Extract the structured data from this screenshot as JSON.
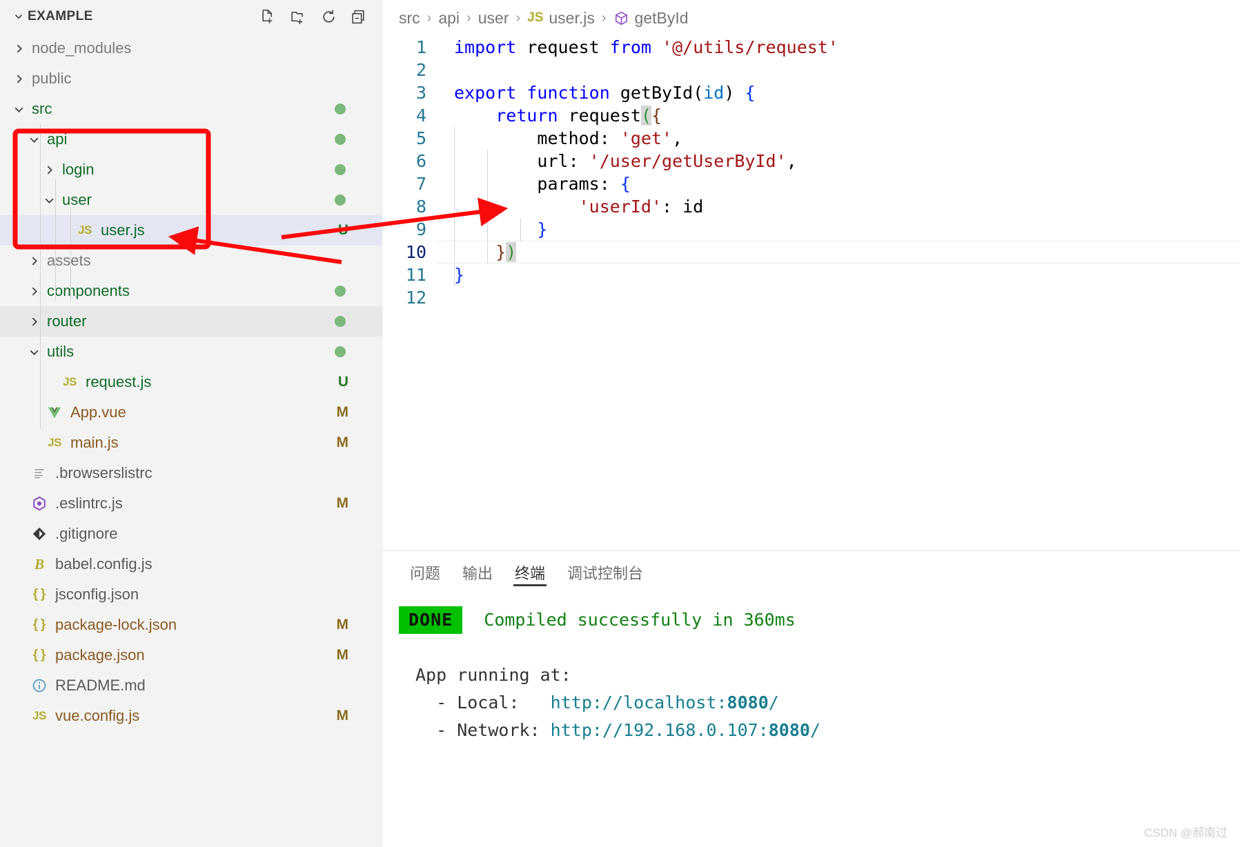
{
  "sidebar": {
    "title": "EXAMPLE",
    "twisty_icon": "chevron-down-icon",
    "actions": [
      {
        "name": "new-file-icon",
        "tooltip": "New File"
      },
      {
        "name": "new-folder-icon",
        "tooltip": "New Folder"
      },
      {
        "name": "refresh-icon",
        "tooltip": "Refresh Explorer"
      },
      {
        "name": "collapse-all-icon",
        "tooltip": "Collapse Folders in Explorer"
      }
    ],
    "tree": [
      {
        "label": "node_modules",
        "type": "folder",
        "state": "collapsed",
        "depth": 0,
        "color": "dim",
        "badge": "",
        "dot": false,
        "selected": false,
        "hover": false
      },
      {
        "label": "public",
        "type": "folder",
        "state": "collapsed",
        "depth": 0,
        "color": "dim",
        "badge": "",
        "dot": false,
        "selected": false,
        "hover": false
      },
      {
        "label": "src",
        "type": "folder",
        "state": "expanded",
        "depth": 0,
        "color": "folder",
        "badge": "",
        "dot": true,
        "selected": false,
        "hover": false
      },
      {
        "label": "api",
        "type": "folder",
        "state": "expanded",
        "depth": 1,
        "color": "folder",
        "badge": "",
        "dot": true,
        "selected": false,
        "hover": false
      },
      {
        "label": "login",
        "type": "folder",
        "state": "collapsed",
        "depth": 2,
        "color": "folder",
        "badge": "",
        "dot": true,
        "selected": false,
        "hover": false
      },
      {
        "label": "user",
        "type": "folder",
        "state": "expanded",
        "depth": 2,
        "color": "folder",
        "badge": "",
        "dot": true,
        "selected": false,
        "hover": false
      },
      {
        "label": "user.js",
        "type": "js",
        "state": "file",
        "depth": 3,
        "color": "folder",
        "badge": "U",
        "dot": false,
        "selected": true,
        "hover": false
      },
      {
        "label": "assets",
        "type": "folder",
        "state": "collapsed",
        "depth": 1,
        "color": "dim",
        "badge": "",
        "dot": false,
        "selected": false,
        "hover": false
      },
      {
        "label": "components",
        "type": "folder",
        "state": "collapsed",
        "depth": 1,
        "color": "folder",
        "badge": "",
        "dot": true,
        "selected": false,
        "hover": false
      },
      {
        "label": "router",
        "type": "folder",
        "state": "collapsed",
        "depth": 1,
        "color": "folder",
        "badge": "",
        "dot": true,
        "selected": false,
        "hover": true
      },
      {
        "label": "utils",
        "type": "folder",
        "state": "expanded",
        "depth": 1,
        "color": "folder",
        "badge": "",
        "dot": true,
        "selected": false,
        "hover": false
      },
      {
        "label": "request.js",
        "type": "js",
        "state": "file",
        "depth": 2,
        "color": "folder",
        "badge": "U",
        "dot": false,
        "selected": false,
        "hover": false
      },
      {
        "label": "App.vue",
        "type": "vue",
        "state": "file",
        "depth": 1,
        "color": "json",
        "badge": "M",
        "dot": false,
        "selected": false,
        "hover": false
      },
      {
        "label": "main.js",
        "type": "js",
        "state": "file",
        "depth": 1,
        "color": "json",
        "badge": "M",
        "dot": false,
        "selected": false,
        "hover": false
      },
      {
        "label": ".browserslistrc",
        "type": "lines",
        "state": "file",
        "depth": 0,
        "color": "plain",
        "badge": "",
        "dot": false,
        "selected": false,
        "hover": false
      },
      {
        "label": ".eslintrc.js",
        "type": "eslint",
        "state": "file",
        "depth": 0,
        "color": "plain",
        "badge": "M",
        "dot": false,
        "selected": false,
        "hover": false
      },
      {
        "label": ".gitignore",
        "type": "git",
        "state": "file",
        "depth": 0,
        "color": "plain",
        "badge": "",
        "dot": false,
        "selected": false,
        "hover": false
      },
      {
        "label": "babel.config.js",
        "type": "babel",
        "state": "file",
        "depth": 0,
        "color": "plain",
        "badge": "",
        "dot": false,
        "selected": false,
        "hover": false
      },
      {
        "label": "jsconfig.json",
        "type": "json",
        "state": "file",
        "depth": 0,
        "color": "plain",
        "badge": "",
        "dot": false,
        "selected": false,
        "hover": false
      },
      {
        "label": "package-lock.json",
        "type": "json",
        "state": "file",
        "depth": 0,
        "color": "json",
        "badge": "M",
        "dot": false,
        "selected": false,
        "hover": false
      },
      {
        "label": "package.json",
        "type": "json",
        "state": "file",
        "depth": 0,
        "color": "json",
        "badge": "M",
        "dot": false,
        "selected": false,
        "hover": false
      },
      {
        "label": "README.md",
        "type": "info",
        "state": "file",
        "depth": 0,
        "color": "plain",
        "badge": "",
        "dot": false,
        "selected": false,
        "hover": false
      },
      {
        "label": "vue.config.js",
        "type": "js",
        "state": "file",
        "depth": 0,
        "color": "json",
        "badge": "M",
        "dot": false,
        "selected": false,
        "hover": false
      }
    ]
  },
  "breadcrumb": {
    "items": [
      {
        "label": "src",
        "icon": ""
      },
      {
        "label": "api",
        "icon": ""
      },
      {
        "label": "user",
        "icon": ""
      },
      {
        "label": "user.js",
        "icon": "js-file-icon"
      },
      {
        "label": "getById",
        "icon": "symbol-cube-icon"
      }
    ],
    "separator": "›"
  },
  "editor": {
    "language": "javascript",
    "lines": [
      {
        "num": "1",
        "text": "import request from '@/utils/request'"
      },
      {
        "num": "2",
        "text": ""
      },
      {
        "num": "3",
        "text": "export function getById(id) {"
      },
      {
        "num": "4",
        "text": "    return request({"
      },
      {
        "num": "5",
        "text": "        method: 'get',"
      },
      {
        "num": "6",
        "text": "        url: '/user/getUserById',"
      },
      {
        "num": "7",
        "text": "        params: {"
      },
      {
        "num": "8",
        "text": "            'userId': id"
      },
      {
        "num": "9",
        "text": "        }"
      },
      {
        "num": "10",
        "text": "    })"
      },
      {
        "num": "11",
        "text": "}"
      },
      {
        "num": "12",
        "text": ""
      }
    ]
  },
  "panel": {
    "tabs": [
      {
        "label": "问题",
        "active": false
      },
      {
        "label": "输出",
        "active": false
      },
      {
        "label": "终端",
        "active": true
      },
      {
        "label": "调试控制台",
        "active": false
      }
    ],
    "terminal": {
      "status_badge": "DONE",
      "status_text": "Compiled successfully in 360ms",
      "app_running_label": "App running at:",
      "entries": [
        {
          "prefix": "  - Local:   ",
          "scheme": "http://localhost:",
          "port": "8080",
          "suffix": "/"
        },
        {
          "prefix": "  - Network: ",
          "scheme": "http://192.168.0.107:",
          "port": "8080",
          "suffix": "/"
        }
      ]
    }
  },
  "annotations": {
    "highlight_color": "#fb0a0a",
    "rect_label": "api-folder-highlight",
    "arrows": [
      {
        "name": "arrow-to-userjs-from-code"
      },
      {
        "name": "arrow-to-params-line"
      }
    ]
  },
  "watermark": {
    "text": "CSDN @郝南过"
  },
  "colors": {
    "selection": "#e4e6f1",
    "hover": "#e8e8e8",
    "git_dot": "#7cb87c",
    "modified": "#8a6d1e",
    "untracked": "#2a7a2a",
    "keyword": "#0000ff",
    "string": "#a31515",
    "param": "#0070c1",
    "linenum": "#237893",
    "terminal_green": "#118011",
    "terminal_url": "#177e8f",
    "done_badge_bg": "#00c000"
  }
}
